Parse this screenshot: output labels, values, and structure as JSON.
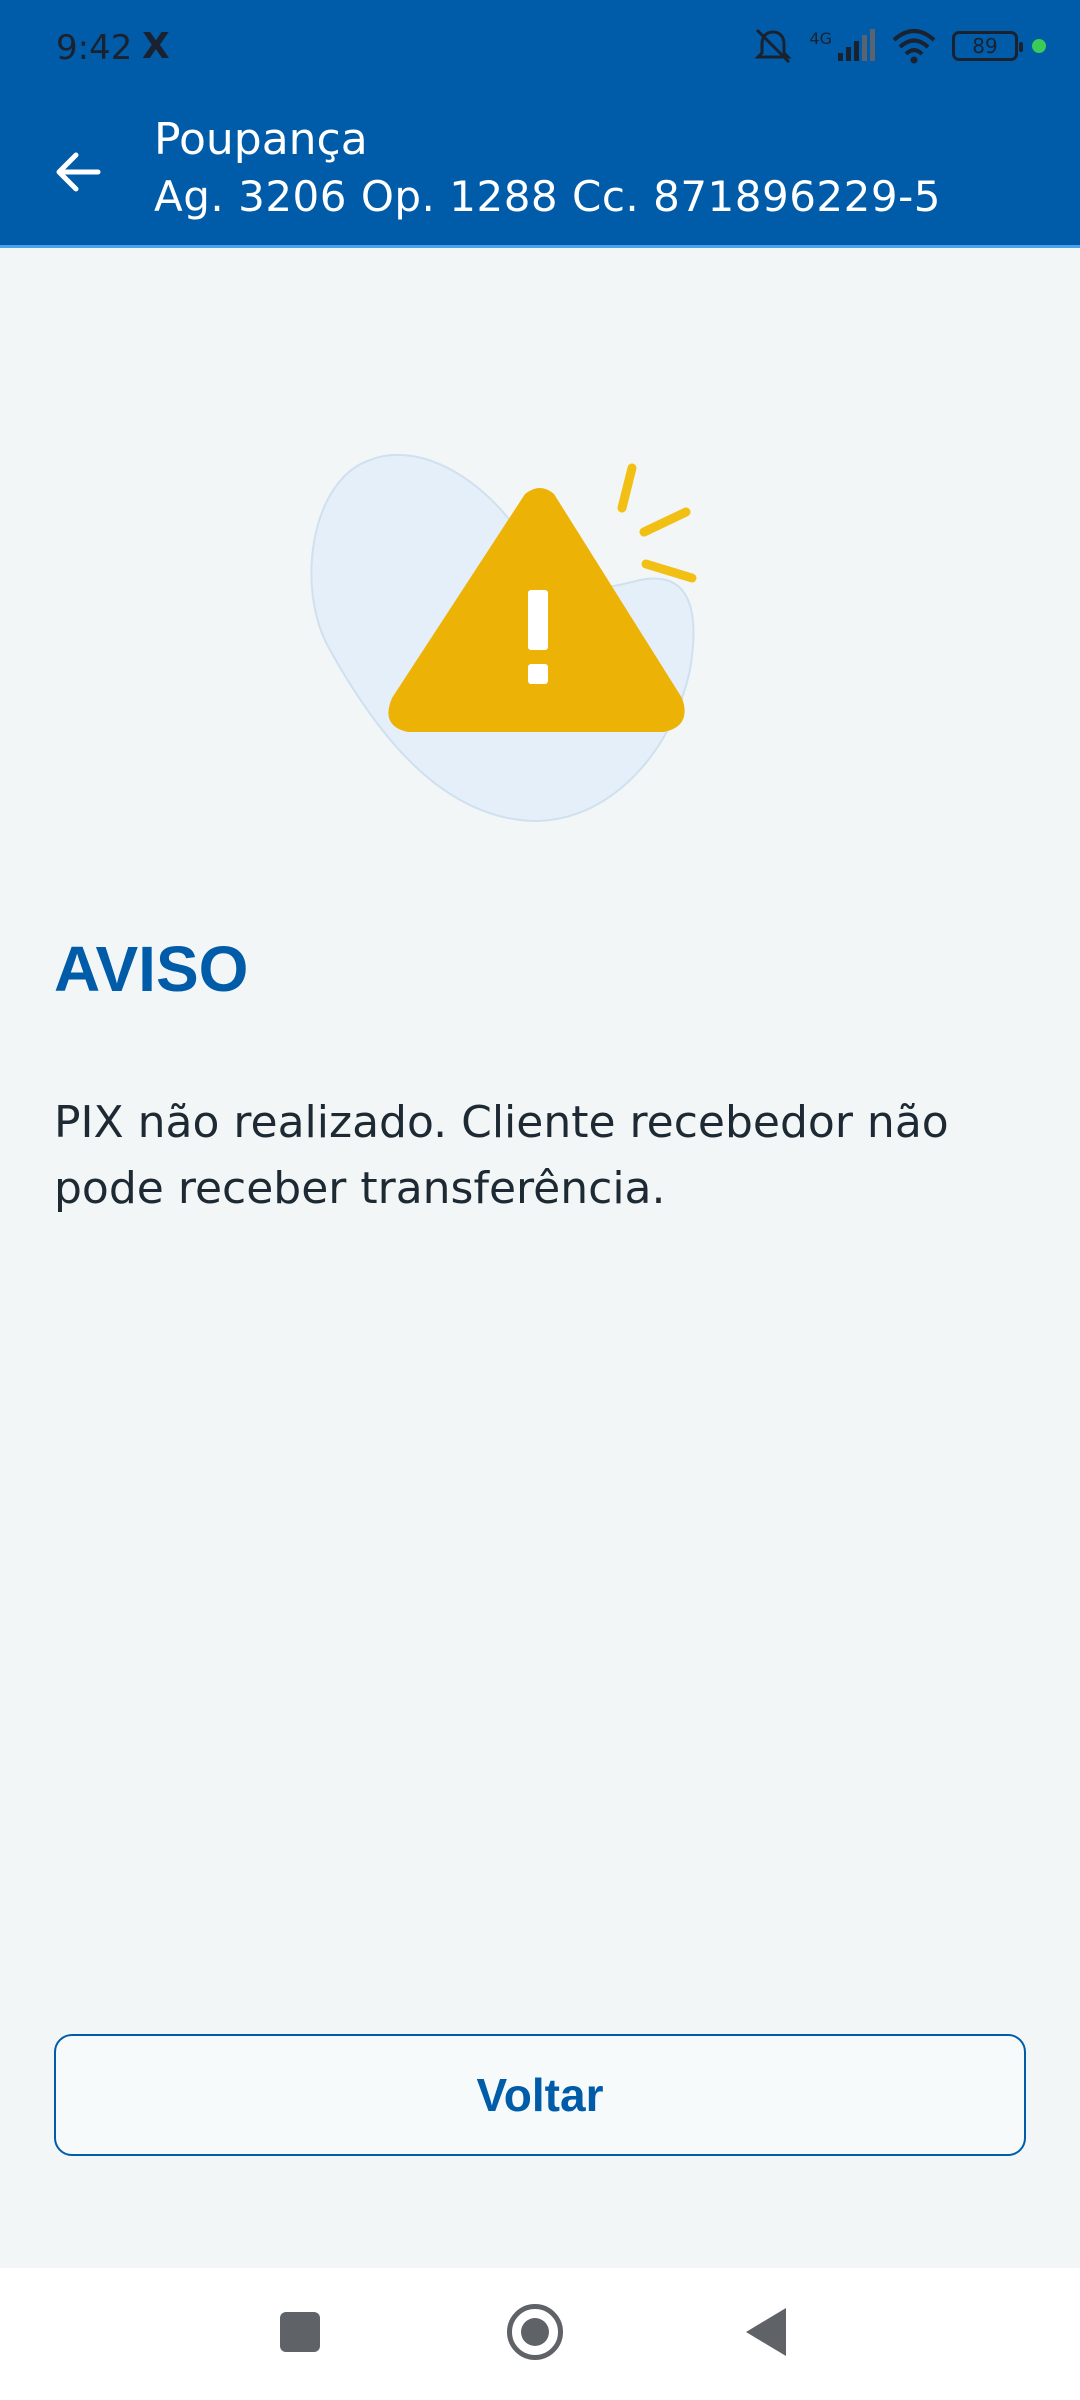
{
  "status_bar": {
    "time": "9:42",
    "carrier_glyph": "X",
    "network_label": "4G",
    "battery_level": "89",
    "icons": [
      "mute-icon",
      "signal-icon",
      "wifi-icon",
      "battery-icon",
      "dot-indicator"
    ]
  },
  "header": {
    "title": "Poupança",
    "subtitle": "Ag. 3206 Op. 1288 Cc. 871896229-5",
    "back_icon": "arrow-left-icon"
  },
  "content": {
    "illustration_icon": "warning-triangle-icon",
    "heading": "AVISO",
    "message": "PIX não realizado. Cliente recebedor não pode receber transferência."
  },
  "actions": {
    "voltar_label": "Voltar"
  },
  "colors": {
    "brand_blue": "#005ca9",
    "warning_yellow": "#ecb206",
    "background": "#f3f6f7"
  },
  "nav": {
    "icons": [
      "recents-icon",
      "home-icon",
      "back-icon"
    ]
  }
}
